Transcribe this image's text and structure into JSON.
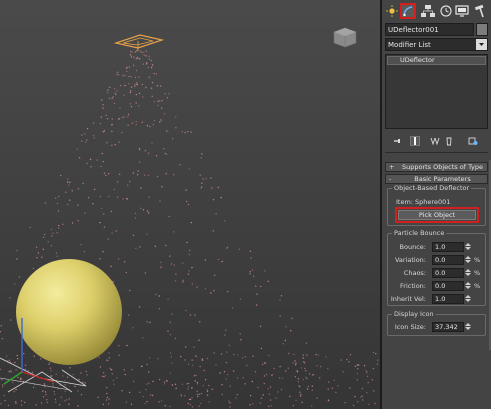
{
  "command_panel": {
    "tabs": [
      {
        "name": "create",
        "icon": "sun-icon"
      },
      {
        "name": "modify",
        "icon": "modify-arc-icon",
        "active": true,
        "highlight_color": "#d02020"
      },
      {
        "name": "hierarchy",
        "icon": "hierarchy-icon"
      },
      {
        "name": "motion",
        "icon": "motion-icon"
      },
      {
        "name": "display",
        "icon": "display-monitor-icon"
      },
      {
        "name": "utilities",
        "icon": "hammer-icon"
      }
    ],
    "object_name": "UDeflector001",
    "object_color": "#7c7c7c",
    "modifier_list_label": "Modifier List",
    "stack_items": [
      "UDeflector"
    ],
    "stack_toolbar_icons": [
      "pin-stack-icon",
      "show-end-result-icon",
      "make-unique-icon",
      "remove-modifier-icon",
      "configure-sets-icon"
    ]
  },
  "rollouts": {
    "supports": {
      "sign": "+",
      "label": "Supports Objects of Type"
    },
    "basic": {
      "sign": "-",
      "label": "Basic Parameters"
    }
  },
  "object_based": {
    "title": "Object-Based Deflector",
    "item_label": "Item: Sphere001",
    "pick_button": "Pick Object",
    "pick_highlight_color": "#d02020"
  },
  "particle_bounce": {
    "title": "Particle Bounce",
    "fields": [
      {
        "label": "Bounce:",
        "value": "1.0",
        "unit": ""
      },
      {
        "label": "Variation:",
        "value": "0.0",
        "unit": "%"
      },
      {
        "label": "Chaos:",
        "value": "0.0",
        "unit": "%"
      },
      {
        "label": "Friction:",
        "value": "0.0",
        "unit": "%"
      },
      {
        "label": "Inherit Vel:",
        "value": "1.0",
        "unit": ""
      }
    ]
  },
  "display_icon": {
    "title": "Display Icon",
    "icon_size_label": "Icon Size:",
    "icon_size_value": "37.342"
  },
  "viewport": {
    "sphere_color": "#d8cc66",
    "particle_color": "#c98a8a",
    "emitter_color": "#e8a24a"
  }
}
